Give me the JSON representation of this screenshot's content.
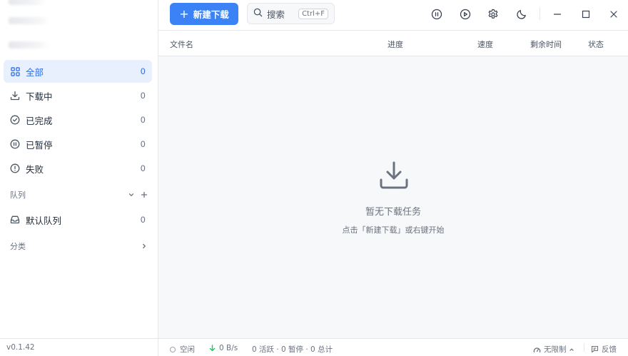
{
  "sidebar": {
    "items": [
      {
        "label": "全部",
        "count": "0",
        "icon": "grid-icon",
        "active": true
      },
      {
        "label": "下载中",
        "count": "0",
        "icon": "download-icon"
      },
      {
        "label": "已完成",
        "count": "0",
        "icon": "check-circle-icon"
      },
      {
        "label": "已暂停",
        "count": "0",
        "icon": "pause-circle-icon"
      },
      {
        "label": "失败",
        "count": "0",
        "icon": "alert-circle-icon"
      }
    ],
    "queue_section": "队列",
    "queues": [
      {
        "label": "默认队列",
        "count": "0",
        "icon": "inbox-icon"
      }
    ],
    "category_section": "分类",
    "version": "v0.1.42"
  },
  "toolbar": {
    "new_download_label": "新建下载",
    "search_placeholder": "搜索",
    "search_shortcut": "Ctrl+F",
    "icons": [
      "pause-all-icon",
      "resume-all-icon",
      "settings-icon",
      "theme-moon-icon",
      "minimize-icon",
      "maximize-icon",
      "close-icon"
    ]
  },
  "table": {
    "columns": [
      "文件名",
      "进度",
      "速度",
      "剩余时间",
      "状态"
    ]
  },
  "empty_state": {
    "title": "暂无下载任务",
    "hint": "点击「新建下载」或右键开始"
  },
  "statusbar": {
    "state": "空闲",
    "speed": "0 B/s",
    "summary": "0 活跃 · 0 暂停 · 0 总计",
    "limit": "无限制",
    "feedback": "反馈"
  },
  "colors": {
    "accent": "#3b82f6",
    "active_bg": "#e8effd",
    "speed_arrow": "#22c55e"
  }
}
